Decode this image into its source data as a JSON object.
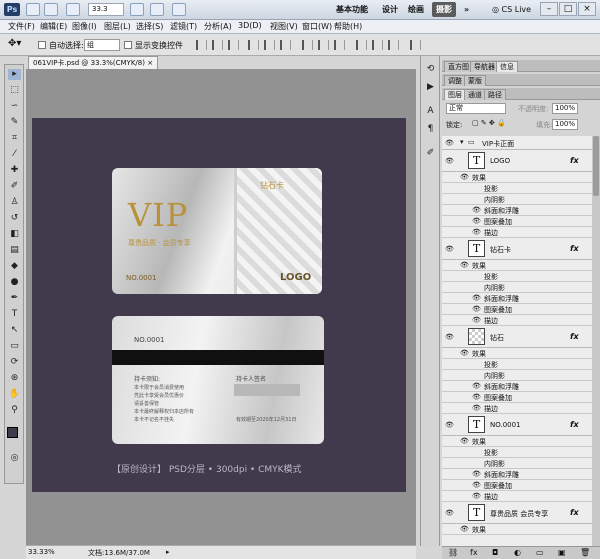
{
  "app": {
    "logo": "Ps",
    "zoom": "33.3",
    "workspaces": [
      "基本功能",
      "设计",
      "绘画",
      "摄影"
    ],
    "active_workspace": "摄影",
    "cs_live": "CS Live"
  },
  "menu": [
    "文件(F)",
    "编辑(E)",
    "图像(I)",
    "图层(L)",
    "选择(S)",
    "滤镜(T)",
    "分析(A)",
    "3D(D)",
    "视图(V)",
    "窗口(W)",
    "帮助(H)"
  ],
  "options": {
    "auto_select_label": "自动选择:",
    "auto_select_value": "组",
    "show_transform_label": "显示变换控件"
  },
  "document": {
    "tab_title": "061VIP卡.psd @ 33.3%(CMYK/8)",
    "status_zoom": "33.33%",
    "status_doc": "文档:13.6M/37.0M"
  },
  "artwork": {
    "front": {
      "vip": "VIP",
      "tagline": "尊贵品质 · 会员专享",
      "card_no": "NO.0001",
      "logo": "LOGO",
      "badge": "钻石卡"
    },
    "back": {
      "card_no": "NO.0001",
      "notice_title": "持卡须知:",
      "notice_lines": [
        "本卡限于会员消费使用",
        "凭此卡享受会员优惠价",
        "请妥善保管",
        "本卡最终解释权归本店所有",
        "本卡不记名不挂失"
      ],
      "sig_label": "持卡人签名",
      "date_text": "有效期至2020年12月31日"
    },
    "footer": "【原创设计】    PSD分层 • 300dpi • CMYK模式"
  },
  "panels": {
    "tabs_top": [
      "直方图",
      "导航器",
      "信息"
    ],
    "active_top": "信息",
    "tabs_mid": [
      "调整",
      "蒙版"
    ],
    "tabs_layers": [
      "图层",
      "通道",
      "路径"
    ],
    "active_layers": "图层",
    "blend_mode": "正常",
    "opacity_label": "不透明度:",
    "opacity_value": "100%",
    "lock_label": "锁定:",
    "fill_label": "填充:",
    "fill_value": "100%",
    "group_name": "VIP卡正面",
    "layers": [
      {
        "name": "LOGO",
        "thumb": "T",
        "effects": [
          "效果",
          "投影",
          "内阴影",
          "斜面和浮雕",
          "图案叠加",
          "描边"
        ]
      },
      {
        "name": "钻石卡",
        "thumb": "T",
        "effects": [
          "效果",
          "投影",
          "内阴影",
          "斜面和浮雕",
          "图案叠加",
          "描边"
        ]
      },
      {
        "name": "钻石",
        "thumb": "",
        "effects": [
          "效果",
          "投影",
          "内阴影",
          "斜面和浮雕",
          "图案叠加",
          "描边"
        ]
      },
      {
        "name": "NO.0001",
        "thumb": "T",
        "effects": [
          "效果",
          "投影",
          "内阴影",
          "斜面和浮雕",
          "图案叠加",
          "描边"
        ]
      },
      {
        "name": "尊贵品质 会员专享",
        "thumb": "T",
        "effects": [
          "效果"
        ]
      }
    ],
    "fx": "fx"
  },
  "colors": {
    "canvas_bg": "#403a4c",
    "gold": "#b8923a",
    "active_ws": "#5b5b5b"
  }
}
